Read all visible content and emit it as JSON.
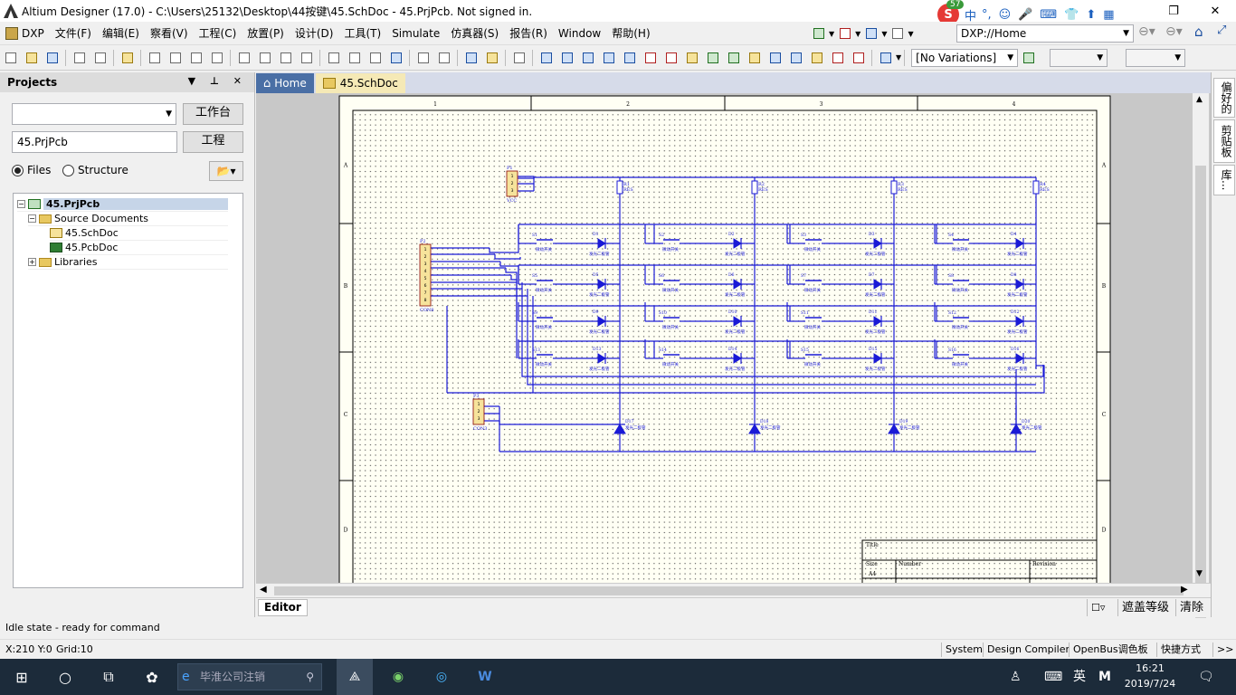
{
  "window": {
    "title": "Altium Designer (17.0) - C:\\Users\\25132\\Desktop\\44按键\\45.SchDoc - 45.PrjPcb. Not signed in."
  },
  "menu": [
    "DXP",
    "文件(F)",
    "编辑(E)",
    "察看(V)",
    "工程(C)",
    "放置(P)",
    "设计(D)",
    "工具(T)",
    "Simulate",
    "仿真器(S)",
    "报告(R)",
    "Window",
    "帮助(H)"
  ],
  "address": "DXP://Home",
  "variations": "[No Variations]",
  "ime": {
    "badge": "57",
    "cn": "中",
    "dot": "°,"
  },
  "projects_panel": {
    "title": "Projects",
    "workspace_button": "工作台",
    "project_button": "工程",
    "project_name": "45.PrjPcb",
    "radio_files": "Files",
    "radio_structure": "Structure",
    "tree": {
      "project": "45.PrjPcb",
      "source_documents": "Source Documents",
      "schdoc": "45.SchDoc",
      "pcbdoc": "45.PcbDoc",
      "libraries": "Libraries"
    }
  },
  "tabs": {
    "home": "Home",
    "active": "45.SchDoc"
  },
  "schematic": {
    "columns": [
      "1",
      "2",
      "3",
      "4"
    ],
    "rows": [
      "A",
      "B",
      "C",
      "D"
    ],
    "connectors": {
      "top": "P1",
      "left": "P2",
      "bottom": "P3",
      "left_label": "CON8",
      "bottom_label": "CON3",
      "top_label": "VCC"
    },
    "resistors": [
      {
        "ref": "R1",
        "val": "RES"
      },
      {
        "ref": "R2",
        "val": "RES"
      },
      {
        "ref": "R3",
        "val": "RES"
      },
      {
        "ref": "R4",
        "val": "RES"
      }
    ],
    "switches": [
      {
        "ref": "S1"
      },
      {
        "ref": "S2"
      },
      {
        "ref": "S3"
      },
      {
        "ref": "S4"
      },
      {
        "ref": "S5"
      },
      {
        "ref": "S6"
      },
      {
        "ref": "S7"
      },
      {
        "ref": "S8"
      },
      {
        "ref": "S9"
      },
      {
        "ref": "S10"
      },
      {
        "ref": "S11"
      },
      {
        "ref": "S12"
      },
      {
        "ref": "S13"
      },
      {
        "ref": "S14"
      },
      {
        "ref": "S15"
      },
      {
        "ref": "S16"
      }
    ],
    "switch_label": "微动开关",
    "led_label": "发光二极管",
    "bottom_leds": [
      "D17",
      "D18",
      "D19",
      "D20"
    ],
    "title_block": {
      "title": "Title",
      "size": "Size",
      "size_val": "A4",
      "number": "Number",
      "revision": "Revision"
    }
  },
  "editor_tab": "Editor",
  "editor_right": {
    "mask": "遮盖等级",
    "clear": "清除"
  },
  "right_panel": [
    "偏好的",
    "剪贴板",
    "库..."
  ],
  "status": {
    "idle": "Idle state - ready for command",
    "coords": "X:210 Y:0",
    "grid": "Grid:10",
    "buttons": [
      "System",
      "Design Compiler",
      "OpenBus调色板",
      "快捷方式",
      ">>"
    ]
  },
  "taskbar": {
    "search": "毕淮公司注销",
    "time": "16:21",
    "date": "2019/7/24",
    "lang": "英"
  },
  "colors": {
    "wire": "#1a1ad6",
    "sheet": "#fffff4",
    "border": "#8a0000",
    "part": "#f6e39b"
  }
}
